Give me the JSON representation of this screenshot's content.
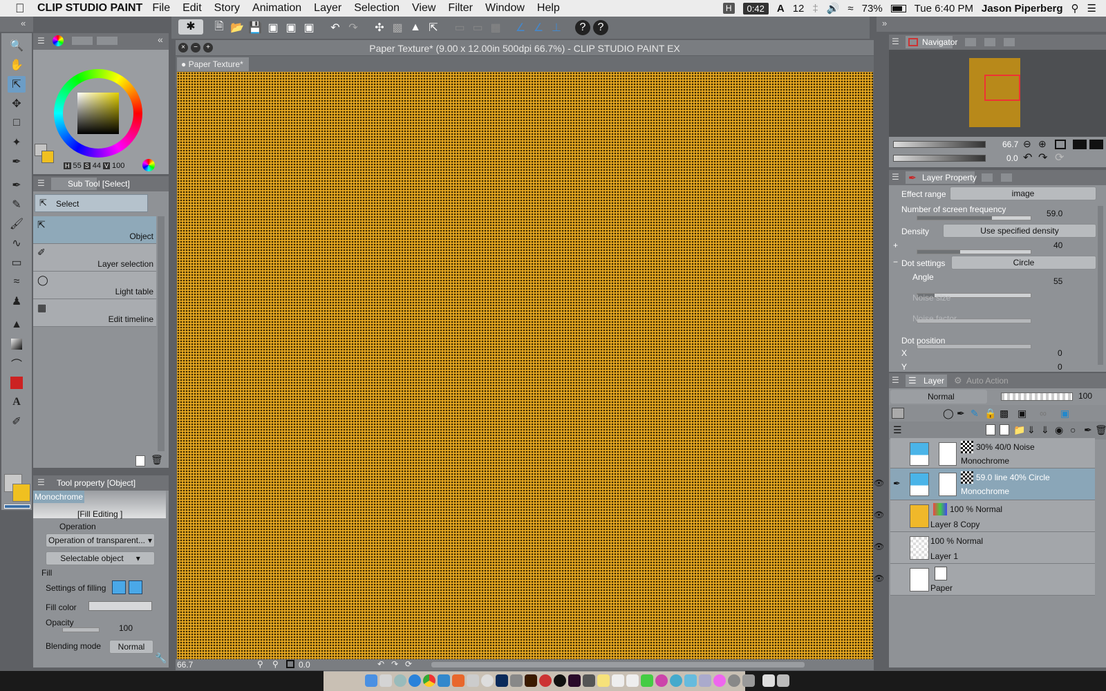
{
  "menubar": {
    "app": "CLIP STUDIO PAINT",
    "items": [
      "File",
      "Edit",
      "Story",
      "Animation",
      "Layer",
      "Selection",
      "View",
      "Filter",
      "Window",
      "Help"
    ],
    "h_badge": "H",
    "timer": "0:42",
    "font_count": "12",
    "battery": "73%",
    "datetime": "Tue 6:40 PM",
    "user": "Jason Piperberg"
  },
  "window": {
    "title": "Paper Texture* (9.00 x 12.00in 500dpi 66.7%)  - CLIP STUDIO PAINT EX",
    "tab": "Paper Texture*"
  },
  "color": {
    "h_label": "H",
    "h": "55",
    "s_label": "S",
    "s": "44",
    "v_label": "V",
    "v": "100"
  },
  "subtool": {
    "title": "Sub Tool [Select]",
    "group": "Select",
    "items": [
      "Object",
      "Layer selection",
      "Light table",
      "Edit timeline"
    ]
  },
  "toolprop": {
    "title": "Tool property [Object]",
    "preview_label": "Monochrome",
    "fill_editing": "[Fill Editing ]",
    "operation_label": "Operation",
    "operation_value": "Operation of transparent...",
    "selectable": "Selectable object",
    "fill_label": "Fill",
    "settings_filling": "Settings of filling",
    "fill_color": "Fill color",
    "opacity_label": "Opacity",
    "opacity_value": "100",
    "blend_label": "Blending mode",
    "blend_value": "Normal"
  },
  "navigator": {
    "title": "Navigator",
    "zoom": "66.7",
    "rotation": "0.0"
  },
  "layerprop": {
    "title": "Layer Property",
    "effect_range": "Effect range",
    "effect_value": "image",
    "screen_freq": "Number of screen frequency",
    "screen_value": "59.0",
    "density": "Density",
    "density_mode": "Use specified density",
    "density_value": "40",
    "dot_settings": "Dot settings",
    "dot_shape": "Circle",
    "angle": "Angle",
    "angle_value": "55",
    "noise_size": "Noise size",
    "noise_factor": "Noise factor",
    "dot_position": "Dot position",
    "x_label": "X",
    "x_value": "0",
    "y_label": "Y",
    "y_value": "0"
  },
  "layers": {
    "tab": "Layer",
    "tab2": "Auto Action",
    "blend": "Normal",
    "opacity": "100",
    "list": [
      {
        "line1": "30% 40/0 Noise",
        "line2": "Monochrome"
      },
      {
        "line1": "59.0 line 40% Circle",
        "line2": "Monochrome"
      },
      {
        "line1": "100 % Normal",
        "line2": "Layer 8 Copy"
      },
      {
        "line1": "100 % Normal",
        "line2": "Layer 1"
      },
      {
        "line1": "",
        "line2": "Paper"
      }
    ]
  },
  "status": {
    "zoom": "66.7",
    "rotation": "0.0"
  },
  "colors": {
    "canvas": "#e7a821",
    "layer_selected": "#8aa6b8",
    "fg_swatch": "#f0c020"
  }
}
